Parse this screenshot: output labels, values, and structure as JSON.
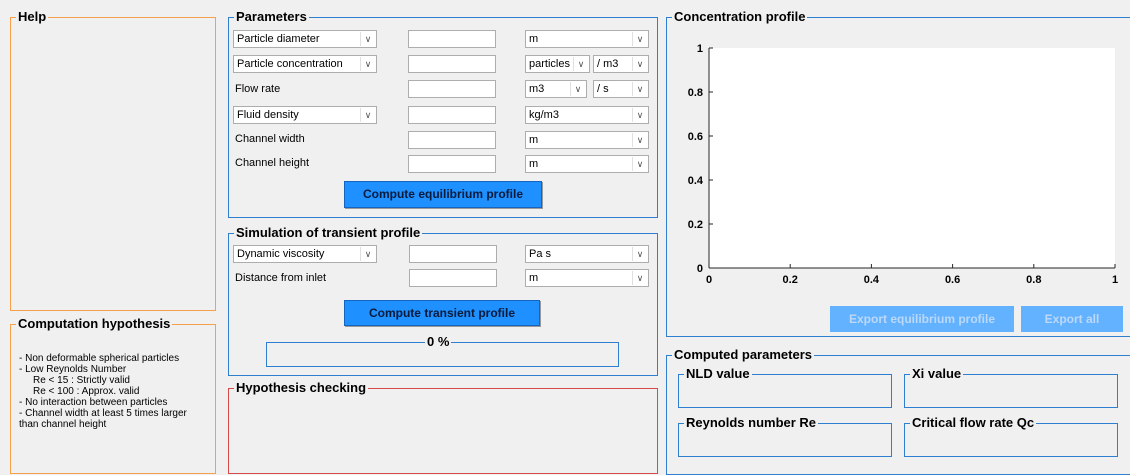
{
  "help": {
    "title": "Help"
  },
  "hypothesis": {
    "title": "Computation hypothesis",
    "lines": [
      "- Non deformable spherical particles",
      "- Low Reynolds Number",
      "Re < 15 : Strictly valid",
      "Re < 100 : Approx. valid",
      "- No interaction between particles",
      "- Channel width at least 5 times larger",
      "than channel height"
    ]
  },
  "parameters": {
    "title": "Parameters",
    "rows": [
      {
        "label": "Particle diameter",
        "is_select": true,
        "value": "",
        "unit": "m",
        "unit2": null
      },
      {
        "label": "Particle concentration",
        "is_select": true,
        "value": "",
        "unit": "particles",
        "unit2": "/ m3"
      },
      {
        "label": "Flow rate",
        "is_select": false,
        "value": "",
        "unit": "m3",
        "unit2": "/ s"
      },
      {
        "label": "Fluid density",
        "is_select": true,
        "value": "",
        "unit": "kg/m3",
        "unit2": null
      },
      {
        "label": "Channel width",
        "is_select": false,
        "value": "",
        "unit": "m",
        "unit2": null
      },
      {
        "label": "Channel height",
        "is_select": false,
        "value": "",
        "unit": "m",
        "unit2": null
      }
    ],
    "compute_button": "Compute equilibrium profile"
  },
  "transient": {
    "title": "Simulation of transient profile",
    "rows": [
      {
        "label": "Dynamic viscosity",
        "is_select": true,
        "value": "",
        "unit": "Pa s"
      },
      {
        "label": "Distance from inlet",
        "is_select": false,
        "value": "",
        "unit": "m"
      }
    ],
    "compute_button": "Compute transient profile",
    "progress_label": "0 %",
    "progress": 0
  },
  "hypothesis_checking": {
    "title": "Hypothesis checking"
  },
  "concentration": {
    "title": "Concentration profile",
    "export_equilibrium": "Export equilibrium profile",
    "export_all": "Export all"
  },
  "chart_data": {
    "type": "line",
    "series": [],
    "xlim": [
      0,
      1
    ],
    "ylim": [
      0,
      1
    ],
    "xticks": [
      "0",
      "0.2",
      "0.4",
      "0.6",
      "0.8",
      "1"
    ],
    "yticks": [
      "0",
      "0.2",
      "0.4",
      "0.6",
      "0.8",
      "1"
    ],
    "grid": false
  },
  "computed": {
    "title": "Computed parameters",
    "nld": "NLD value",
    "xi": "Xi value",
    "re": "Reynolds number Re",
    "qc": "Critical flow rate Qc"
  }
}
